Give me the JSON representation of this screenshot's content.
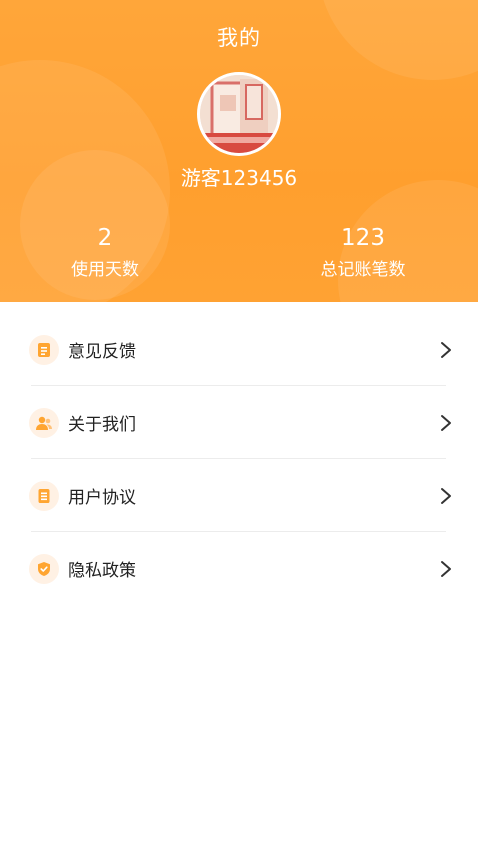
{
  "header": {
    "title": "我的",
    "username": "游客123456",
    "stats": [
      {
        "value": "2",
        "label": "使用天数"
      },
      {
        "value": "123",
        "label": "总记账笔数"
      }
    ]
  },
  "menu": {
    "items": [
      {
        "label": "意见反馈",
        "icon": "feedback-document-icon"
      },
      {
        "label": "关于我们",
        "icon": "users-icon"
      },
      {
        "label": "用户协议",
        "icon": "agreement-icon"
      },
      {
        "label": "隐私政策",
        "icon": "shield-check-icon"
      }
    ]
  },
  "colors": {
    "header_orange": "#ffa63a",
    "icon_orange": "#ffa531",
    "icon_background": "#fff1e4",
    "text_dark": "#222222",
    "divider": "#ececec"
  }
}
